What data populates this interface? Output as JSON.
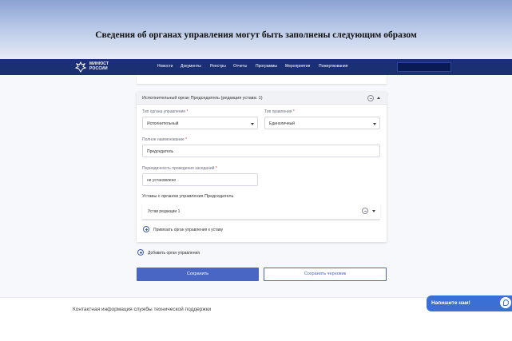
{
  "banner": {
    "title": "Сведения об органах управления могут быть заполнены следующим образом"
  },
  "navbar": {
    "logo_line1": "МИНЮСТ",
    "logo_line2": "РОССИИ",
    "items": [
      {
        "label": "Новости"
      },
      {
        "label": "Документы"
      },
      {
        "label": "Реестры"
      },
      {
        "label": "Отчеты"
      },
      {
        "label": "Программы"
      },
      {
        "label": "Мероприятия"
      },
      {
        "label": "Пожертвования"
      }
    ]
  },
  "card": {
    "title": "Исполнительный орган Председатель (редакция устава: 1)",
    "org_type": {
      "label": "Тип органа управления",
      "required_mark": "*",
      "value": "Исполнительный"
    },
    "governance_type": {
      "label": "Тип правления",
      "required_mark": "*",
      "value": "Единоличный"
    },
    "full_name": {
      "label": "Полное наименование",
      "required_mark": "*",
      "value": "Председатель"
    },
    "meeting_frequency": {
      "label": "Периодичность проведения заседаний",
      "required_mark": "*",
      "value": "не установлено"
    },
    "charters_title": "Уставы с органом управления Председатель",
    "charter_item": "Устав редакции 1",
    "bind_link": "Привязать орган управления к уставу"
  },
  "add_org_link": "Добавить орган управления",
  "buttons": {
    "save": "Сохранить",
    "save_draft": "Сохранить черновик"
  },
  "footer": {
    "support_text": "Контактная информация службы технической поддержки"
  },
  "chat": {
    "label": "Напишите нам!"
  },
  "colors": {
    "navbar": "#1b2f74",
    "primary": "#4a66c4",
    "chat": "#3b6fd4"
  }
}
